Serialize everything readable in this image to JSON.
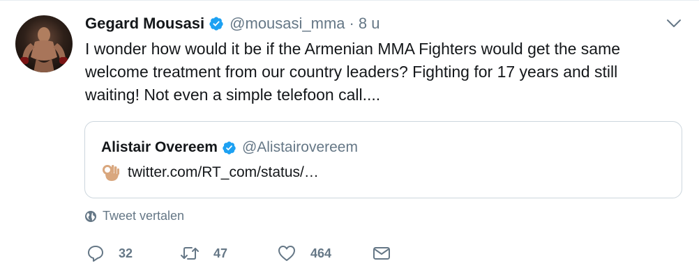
{
  "tweet": {
    "author_name": "Gegard Mousasi",
    "author_handle": "@mousasi_mma",
    "separator": "·",
    "time": "8 u",
    "text": "I wonder how would it be if the Armenian MMA Fighters would get the same welcome treatment from our country leaders? Fighting for 17 years and still waiting! Not even a simple telefoon call....",
    "quoted": {
      "author_name": "Alistair Overeem",
      "author_handle": "@Alistairovereem",
      "emoji_icon": "ok-hand-emoji-icon",
      "link": "twitter.com/RT_com/status/…"
    },
    "translate_label": "Tweet vertalen",
    "actions": {
      "replies": "32",
      "retweets": "47",
      "likes": "464"
    }
  },
  "colors": {
    "text": "#14171a",
    "secondary": "#657786",
    "verified": "#1da1f2",
    "border": "#ccd6dd"
  },
  "icons": [
    "verified-badge-icon",
    "chevron-down-icon",
    "globe-icon",
    "reply-icon",
    "retweet-icon",
    "like-icon",
    "direct-message-icon"
  ]
}
